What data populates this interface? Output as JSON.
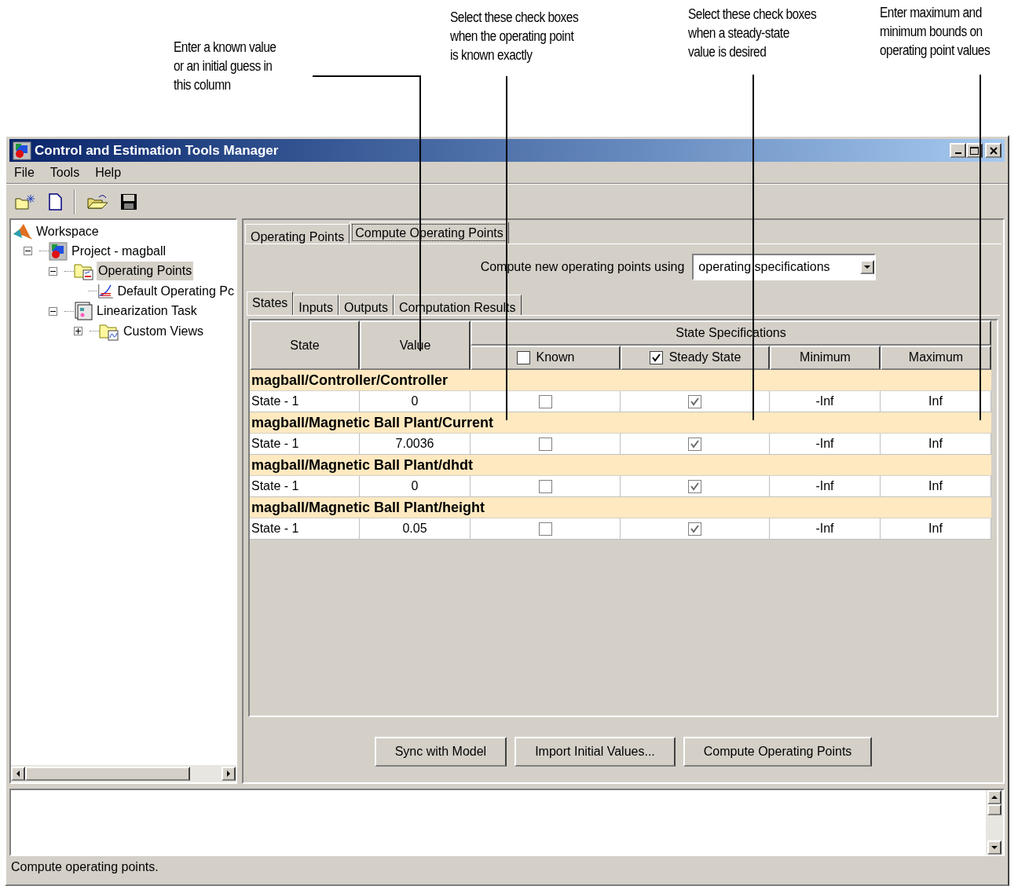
{
  "annotations": [
    {
      "text": "Enter a known value\nor an initial guess in\nthis column"
    },
    {
      "text": "Select these check boxes\nwhen the operating point\nis known exactly"
    },
    {
      "text": "Select these check boxes\nwhen a steady-state\nvalue is desired"
    },
    {
      "text": "Enter maximum and\nminimum bounds on\noperating point values"
    }
  ],
  "window": {
    "title": "Control and Estimation Tools Manager"
  },
  "menu": [
    "File",
    "Tools",
    "Help"
  ],
  "tree_root": {
    "label": "Workspace"
  },
  "tree": [
    {
      "label": "Project - magball",
      "kind": "project",
      "expanded": true,
      "selected": false,
      "children": [
        {
          "label": "Operating Points",
          "kind": "folder",
          "expanded": true,
          "selected": true,
          "children": [
            {
              "label": "Default Operating Pc",
              "kind": "plot",
              "selected": false
            }
          ]
        },
        {
          "label": "Linearization Task",
          "kind": "task",
          "expanded": true,
          "selected": false,
          "children": [
            {
              "label": "Custom Views",
              "kind": "views",
              "expanded": false,
              "selected": false
            }
          ]
        }
      ]
    }
  ],
  "tabs": [
    {
      "label": "Operating Points",
      "selected": false
    },
    {
      "label": "Compute Operating Points",
      "selected": true
    }
  ],
  "compute": {
    "label": "Compute new operating points using",
    "value": "operating specifications"
  },
  "sub_tabs": [
    {
      "label": "States",
      "selected": true
    },
    {
      "label": "Inputs",
      "selected": false
    },
    {
      "label": "Outputs",
      "selected": false
    },
    {
      "label": "Computation Results",
      "selected": false
    }
  ],
  "table": {
    "columns": [
      "State",
      "Value"
    ],
    "group_title": "State Specifications",
    "spec_columns": [
      {
        "label": "Known",
        "kind": "checkbox",
        "checked": false
      },
      {
        "label": "Steady State",
        "kind": "checkbox",
        "checked": true
      },
      {
        "label": "Minimum",
        "kind": "text"
      },
      {
        "label": "Maximum",
        "kind": "text"
      }
    ],
    "groups": [
      {
        "block": "magball/Controller/Controller",
        "rows": [
          {
            "state": "State - 1",
            "value": "0",
            "known": false,
            "steady_state": true,
            "minimum": "-Inf",
            "maximum": "Inf"
          }
        ]
      },
      {
        "block": "magball/Magnetic Ball Plant/Current",
        "rows": [
          {
            "state": "State - 1",
            "value": "7.0036",
            "known": false,
            "steady_state": true,
            "minimum": "-Inf",
            "maximum": "Inf"
          }
        ]
      },
      {
        "block": "magball/Magnetic Ball Plant/dhdt",
        "rows": [
          {
            "state": "State - 1",
            "value": "0",
            "known": false,
            "steady_state": true,
            "minimum": "-Inf",
            "maximum": "Inf"
          }
        ]
      },
      {
        "block": "magball/Magnetic Ball Plant/height",
        "rows": [
          {
            "state": "State - 1",
            "value": "0.05",
            "known": false,
            "steady_state": true,
            "minimum": "-Inf",
            "maximum": "Inf"
          }
        ]
      }
    ]
  },
  "buttons": [
    "Sync with Model",
    "Import Initial Values...",
    "Compute Operating Points"
  ],
  "status": "Compute operating points."
}
